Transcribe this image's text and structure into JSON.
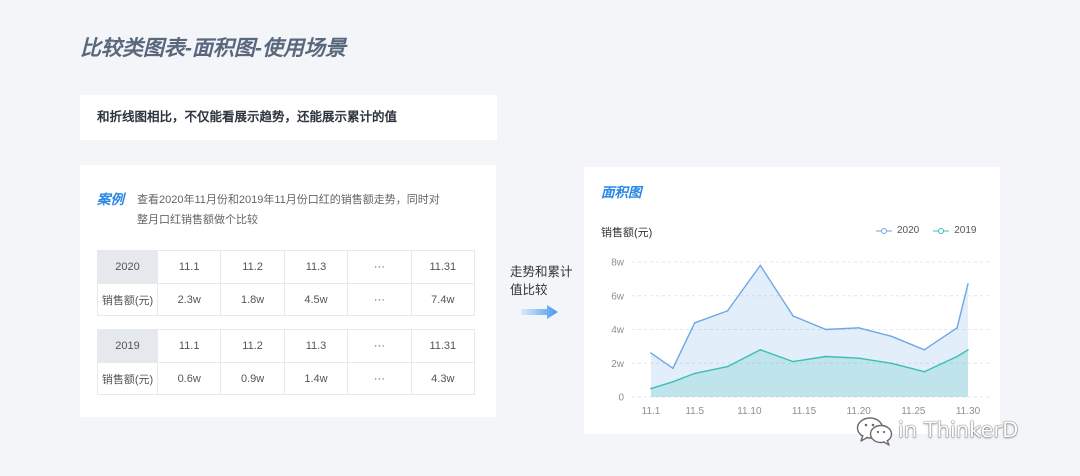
{
  "page": {
    "title": "比较类图表-面积图-使用场景",
    "background": "#f3f5f8",
    "accent": "#2a88e6"
  },
  "summary": {
    "text": "和折线图相比，不仅能看展示趋势，还能展示累计的值"
  },
  "case_card": {
    "label": "案例",
    "description_lines": [
      "查看2020年11月份和2019年11月份口红的销售额走势，同时对",
      "整月口红销售额做个比较"
    ],
    "tables": [
      {
        "year": "2020",
        "dates": [
          "11.1",
          "11.2",
          "11.3",
          "···",
          "11.31"
        ],
        "row_label": "销售额(元)",
        "values": [
          "2.3w",
          "1.8w",
          "4.5w",
          "···",
          "7.4w"
        ]
      },
      {
        "year": "2019",
        "dates": [
          "11.1",
          "11.2",
          "11.3",
          "···",
          "11.31"
        ],
        "row_label": "销售额(元)",
        "values": [
          "0.6w",
          "0.9w",
          "1.4w",
          "···",
          "4.3w"
        ]
      }
    ]
  },
  "transition": {
    "lines": [
      "走势和累计",
      "值比较"
    ],
    "icon": "right-arrow-icon"
  },
  "chart_data": {
    "type": "area",
    "title": "面积图",
    "ylabel": "销售额(元)",
    "x": [
      "11.1",
      "11.3",
      "11.5",
      "11.8",
      "11.11",
      "11.14",
      "11.17",
      "11.20",
      "11.23",
      "11.26",
      "11.29",
      "11.30"
    ],
    "x_ticks": [
      "11.1",
      "11.5",
      "11.10",
      "11.15",
      "11.20",
      "11.25",
      "11.30"
    ],
    "y_ticks": [
      "0",
      "2w",
      "4w",
      "6w",
      "8w"
    ],
    "ylim": [
      0,
      8
    ],
    "series": [
      {
        "name": "2020",
        "color": "#6ea8e4",
        "values": [
          2.6,
          1.7,
          4.4,
          5.1,
          7.8,
          4.8,
          4.0,
          4.1,
          3.6,
          2.8,
          4.1,
          6.7
        ]
      },
      {
        "name": "2019",
        "color": "#3bbfb3",
        "values": [
          0.5,
          0.9,
          1.4,
          1.8,
          2.8,
          2.1,
          2.4,
          2.3,
          2.0,
          1.5,
          2.4,
          2.8
        ]
      }
    ],
    "legend": "top-right",
    "grid": true
  },
  "watermark": {
    "icon": "wechat-icon",
    "text": "in ThinkerD"
  }
}
